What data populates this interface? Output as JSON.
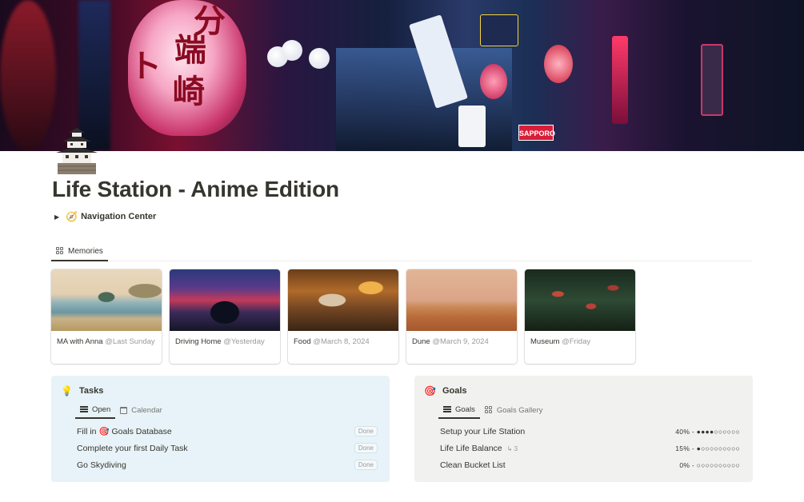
{
  "page": {
    "title": "Life Station - Anime Edition",
    "icon": "japanese-castle-icon"
  },
  "cover": {
    "sign_text": "SAPPORO"
  },
  "toggle": {
    "label": "Navigation Center",
    "icon": "compass-icon"
  },
  "memories": {
    "tab_label": "Memories",
    "cards": [
      {
        "name": "MA with Anna",
        "date": "@Last Sunday"
      },
      {
        "name": "Driving Home",
        "date": "@Yesterday"
      },
      {
        "name": "Food",
        "date": "@March 8, 2024"
      },
      {
        "name": "Dune",
        "date": "@March 9, 2024"
      },
      {
        "name": "Museum",
        "date": "@Friday"
      }
    ]
  },
  "tasks": {
    "heading": "Tasks",
    "icon": "lightbulb-icon",
    "tabs": [
      "Open",
      "Calendar"
    ],
    "rows": [
      {
        "pre": "Fill in",
        "post": "Goals Database",
        "status": "Done"
      },
      {
        "pre": "Complete your first Daily Task",
        "post": "",
        "status": "Done"
      },
      {
        "pre": "Go Skydiving",
        "post": "",
        "status": "Done"
      }
    ]
  },
  "goals": {
    "heading": "Goals",
    "icon": "target-icon",
    "tabs": [
      "Goals",
      "Goals Gallery"
    ],
    "rows": [
      {
        "name": "Setup your Life Station",
        "sub": "",
        "progress": "40% - ●●●●○○○○○○"
      },
      {
        "name": "Life Life Balance",
        "sub": "↳ 3",
        "progress": "15% - ●○○○○○○○○○"
      },
      {
        "name": "Clean Bucket List",
        "sub": "",
        "progress": "0% - ○○○○○○○○○○"
      }
    ]
  }
}
